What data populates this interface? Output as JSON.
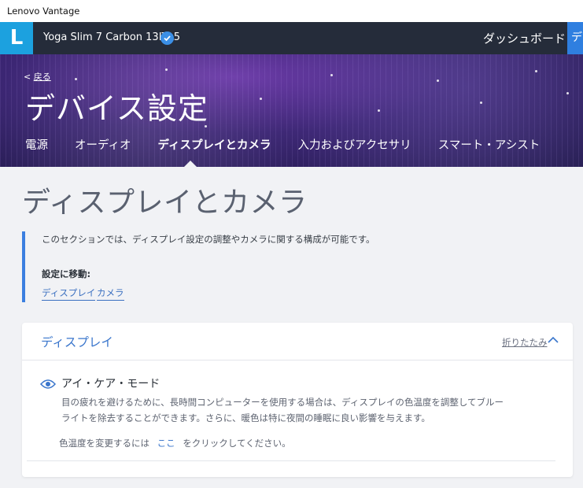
{
  "window": {
    "title": "Lenovo Vantage"
  },
  "topbar": {
    "logo_letter": "L",
    "device_name": "Yoga Slim 7 Carbon 13ITL5",
    "dashboard_label": "ダッシュボード",
    "action_label": "デ"
  },
  "hero": {
    "back_label": "戻る",
    "back_prefix": "<",
    "title": "デバイス設定",
    "tabs": [
      {
        "label": "電源"
      },
      {
        "label": "オーディオ"
      },
      {
        "label": "ディスプレイとカメラ"
      },
      {
        "label": "入力およびアクセサリ"
      },
      {
        "label": "スマート・アシスト"
      }
    ],
    "active_tab": "ディスプレイとカメラ"
  },
  "main": {
    "section_title": "ディスプレイとカメラ",
    "intro": "このセクションでは、ディスプレイ設定の調整やカメラに関する構成が可能です。",
    "goto_label": "設定に移動:",
    "goto_links": [
      {
        "label": "ディスプレイ"
      },
      {
        "label": "カメラ"
      }
    ]
  },
  "display_card": {
    "title": "ディスプレイ",
    "collapse_label": "折りたたみ",
    "eye_care": {
      "title": "アイ・ケア・モード",
      "description": "目の疲れを避けるために、長時間コンピューターを使用する場合は、ディスプレイの色温度を調整してブルーライトを除去することができます。さらに、暖色は特に夜間の睡眠に良い影響を与えます。",
      "color_prefix": "色温度を変更するには",
      "color_link": "ここ",
      "color_suffix": "をクリックしてください。"
    }
  },
  "colors": {
    "accent_blue": "#3b7fe0",
    "logo_blue": "#1ca1df",
    "topbar_bg": "#252c3a"
  }
}
